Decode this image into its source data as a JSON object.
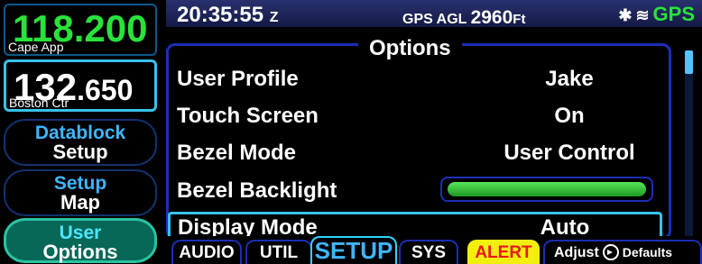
{
  "com": {
    "active": {
      "freq_main": "118",
      "freq_dec": ".200",
      "label": "Cape App"
    },
    "standby": {
      "freq_main": "132",
      "freq_dec": ".650",
      "label": "Boston Ctr"
    }
  },
  "side_buttons": [
    {
      "line1": "Datablock",
      "line2": "Setup"
    },
    {
      "line1": "Setup",
      "line2": "Map"
    },
    {
      "line1": "User",
      "line2": "Options"
    }
  ],
  "status_bar": {
    "time": "20:35:55",
    "time_zone": "Z",
    "gps_agl_label": "GPS AGL",
    "gps_agl_value": "2960",
    "gps_agl_unit": "Ft",
    "bluetooth_icon": "bluetooth-icon",
    "wifi_icon": "wifi-icon",
    "gps_label": "GPS",
    "gps_color": "#29e33a"
  },
  "options": {
    "title": "Options",
    "rows": [
      {
        "label": "User Profile",
        "value": "Jake"
      },
      {
        "label": "Touch Screen",
        "value": "On"
      },
      {
        "label": "Bezel Mode",
        "value": "User Control"
      },
      {
        "label": "Bezel Backlight",
        "value": ""
      },
      {
        "label": "Display Mode",
        "value": "Auto"
      }
    ],
    "bezel_backlight_level": 1.0,
    "scroll_position": 0
  },
  "tabs": [
    {
      "label": "AUDIO"
    },
    {
      "label": "UTIL"
    },
    {
      "label": "SETUP",
      "active": true
    },
    {
      "label": "SYS"
    },
    {
      "label": "ALERT",
      "alert_color": "#f2ef10"
    }
  ],
  "adjust_bar": {
    "label": "Adjust",
    "defaults_label": "Defaults",
    "knob_icon": "knob-icon"
  }
}
